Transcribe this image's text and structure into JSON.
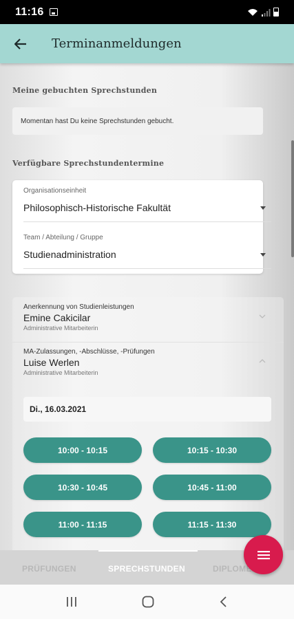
{
  "status_bar": {
    "time": "11:16"
  },
  "header": {
    "title": "Terminanmeldungen",
    "back_icon": "arrow-back-icon"
  },
  "booked": {
    "title": "Meine gebuchten Sprechstunden",
    "empty_text": "Momentan hast Du keine Sprechstunden gebucht."
  },
  "available": {
    "title": "Verfügbare Sprechstundentermine",
    "org_unit": {
      "label": "Organisationseinheit",
      "value": "Philosophisch-Historische Fakultät"
    },
    "team": {
      "label": "Team / Abteilung / Gruppe",
      "value": "Studienadministration"
    }
  },
  "staff": [
    {
      "topic": "Anerkennung von Studienleistungen",
      "name": "Emine Cakicilar",
      "role": "Administrative Mitarbeiterin",
      "expanded": false
    },
    {
      "topic": "MA-Zulassungen, -Abschlüsse, -Prüfungen",
      "name": "Luise Werlen",
      "role": "Administrative Mitarbeiterin",
      "expanded": true
    }
  ],
  "selected_date": "Di., 16.03.2021",
  "slots": [
    "10:00 - 10:15",
    "10:15 - 10:30",
    "10:30 - 10:45",
    "10:45 - 11:00",
    "11:00 - 11:15",
    "11:15 - 11:30"
  ],
  "tabs": [
    {
      "label": "PRÜFUNGEN",
      "active": false
    },
    {
      "label": "SPRECHSTUNDEN",
      "active": true
    },
    {
      "label": "DIPLOMEN",
      "active": false
    }
  ],
  "colors": {
    "app_bar": "#a3d7d2",
    "slot": "#3a9489",
    "fab": "#d81b4d"
  },
  "fab_icon": "menu-icon"
}
